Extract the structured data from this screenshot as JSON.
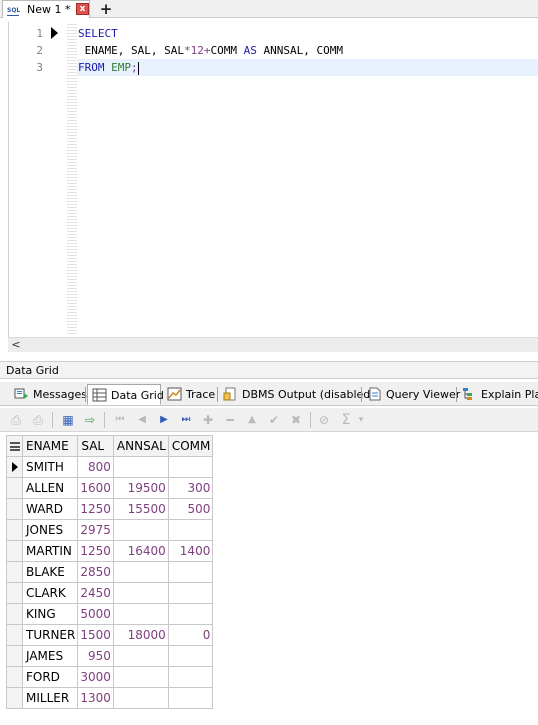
{
  "editor_tab": {
    "title": "New 1 *",
    "icon": "sql-file-icon",
    "close_glyph": "x",
    "add_glyph": "+"
  },
  "editor": {
    "line_numbers": [
      "1",
      "2",
      "3"
    ],
    "lines": [
      [
        {
          "t": "SELECT",
          "c": "kw"
        }
      ],
      [
        {
          "t": " ENAME, SAL, SAL",
          "c": "id"
        },
        {
          "t": "*",
          "c": "op"
        },
        {
          "t": "12",
          "c": "num"
        },
        {
          "t": "+",
          "c": "op"
        },
        {
          "t": "COMM ",
          "c": "id"
        },
        {
          "t": "AS",
          "c": "kw"
        },
        {
          "t": " ANNSAL, COMM",
          "c": "id"
        }
      ],
      [
        {
          "t": "FROM",
          "c": "kw"
        },
        {
          "t": " ",
          "c": "id"
        },
        {
          "t": "EMP",
          "c": "tbl"
        },
        {
          "t": ";",
          "c": "op"
        }
      ]
    ],
    "scroll_left_glyph": "<"
  },
  "panel_title": "Data Grid",
  "result_tabs": [
    {
      "label": "Messages",
      "icon": "messages-icon",
      "active": false
    },
    {
      "label": "Data Grid",
      "icon": "data-grid-icon",
      "active": true
    },
    {
      "label": "Trace",
      "icon": "trace-icon",
      "active": false
    },
    {
      "label": "DBMS Output (disabled)",
      "icon": "dbms-output-icon",
      "active": false
    },
    {
      "label": "Query Viewer",
      "icon": "query-viewer-icon",
      "active": false
    },
    {
      "label": "Explain Plan",
      "icon": "explain-plan-icon",
      "active": false
    }
  ],
  "toolbar": [
    {
      "icon": "save-icon",
      "glyph": "⎙",
      "enabled": false
    },
    {
      "icon": "export-icon",
      "glyph": "⎙",
      "enabled": false
    },
    {
      "icon": "grid-view-icon",
      "glyph": "▦",
      "enabled": true
    },
    {
      "icon": "refresh-grid-icon",
      "glyph": "⇨",
      "enabled": true
    },
    {
      "icon": "first-record-icon",
      "glyph": "⏮",
      "enabled": false
    },
    {
      "icon": "prior-record-icon",
      "glyph": "◀",
      "enabled": false
    },
    {
      "icon": "next-record-icon",
      "glyph": "▶",
      "enabled": true
    },
    {
      "icon": "last-record-icon",
      "glyph": "⏭",
      "enabled": true
    },
    {
      "icon": "insert-record-icon",
      "glyph": "✚",
      "enabled": false
    },
    {
      "icon": "delete-record-icon",
      "glyph": "━",
      "enabled": false
    },
    {
      "icon": "edit-record-icon",
      "glyph": "▲",
      "enabled": false
    },
    {
      "icon": "post-edit-icon",
      "glyph": "✔",
      "enabled": false
    },
    {
      "icon": "cancel-edit-icon",
      "glyph": "✖",
      "enabled": false
    },
    {
      "icon": "filter-icon",
      "glyph": "⊘",
      "enabled": false
    },
    {
      "icon": "sum-icon",
      "glyph": "Σ",
      "enabled": false
    },
    {
      "icon": "dropdown-arrow-icon",
      "glyph": "▾",
      "enabled": false
    }
  ],
  "grid": {
    "columns": [
      "ENAME",
      "SAL",
      "ANNSAL",
      "COMM"
    ],
    "rows": [
      [
        "SMITH",
        "800",
        "",
        ""
      ],
      [
        "ALLEN",
        "1600",
        "19500",
        "300"
      ],
      [
        "WARD",
        "1250",
        "15500",
        "500"
      ],
      [
        "JONES",
        "2975",
        "",
        ""
      ],
      [
        "MARTIN",
        "1250",
        "16400",
        "1400"
      ],
      [
        "BLAKE",
        "2850",
        "",
        ""
      ],
      [
        "CLARK",
        "2450",
        "",
        ""
      ],
      [
        "KING",
        "5000",
        "",
        ""
      ],
      [
        "TURNER",
        "1500",
        "18000",
        "0"
      ],
      [
        "JAMES",
        "950",
        "",
        ""
      ],
      [
        "FORD",
        "3000",
        "",
        ""
      ],
      [
        "MILLER",
        "1300",
        "",
        ""
      ]
    ],
    "current_row": 0
  },
  "colors": {
    "keyword": "#1a1aa6",
    "table_name": "#2e7d32",
    "operator": "#7f3f7f",
    "current_line": "#e8f2fe"
  }
}
